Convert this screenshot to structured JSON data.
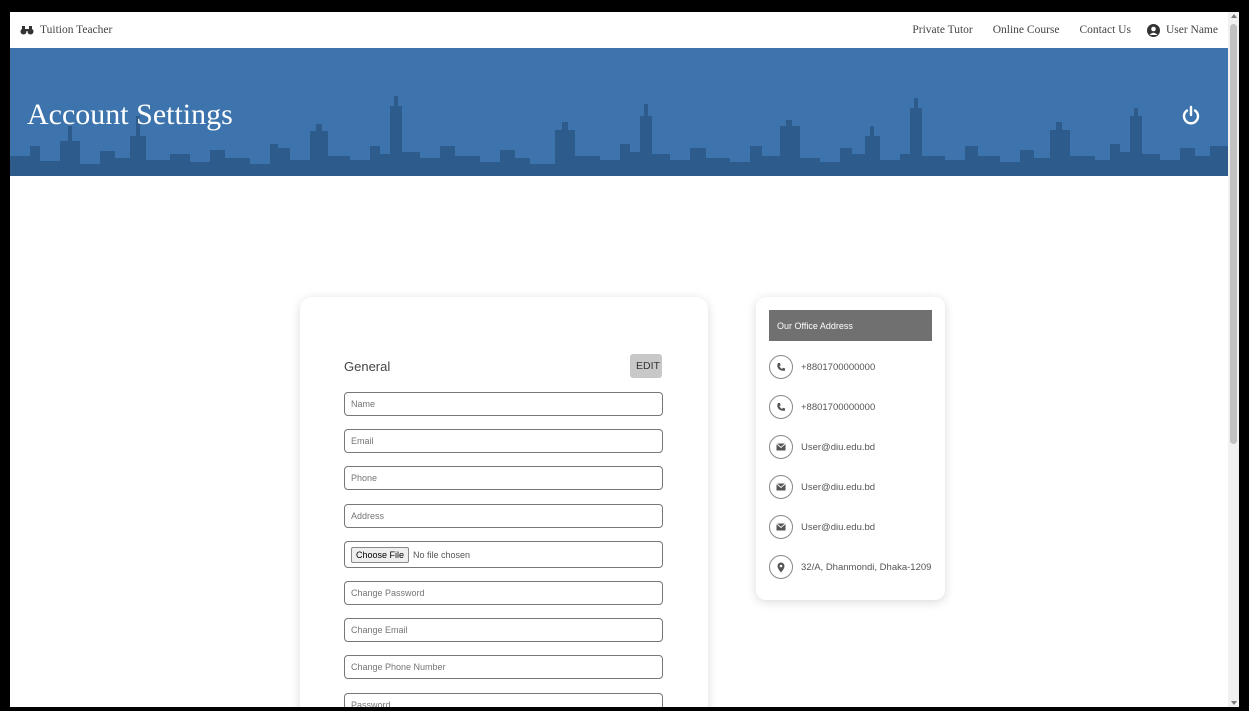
{
  "nav": {
    "brand": "Tuition Teacher",
    "links": [
      "Private Tutor",
      "Online Course",
      "Contact Us"
    ],
    "user": "User Name"
  },
  "banner": {
    "title": "Account Settings"
  },
  "general": {
    "title": "General",
    "edit_label": "EDIT",
    "fields": {
      "name": "Name",
      "email": "Email",
      "phone": "Phone",
      "address": "Address",
      "change_password": "Change Password",
      "change_email": "Change Email",
      "change_phone": "Change Phone Number",
      "password": "Password"
    },
    "file": {
      "button": "Choose File",
      "status": "No file chosen"
    }
  },
  "office": {
    "title": "Our Office Address",
    "phones": [
      "+8801700000000",
      "+8801700000000"
    ],
    "emails": [
      "User@diu.edu.bd",
      "User@diu.edu.bd",
      "User@diu.edu.bd"
    ],
    "address": "32/A, Dhanmondi, Dhaka-1209"
  },
  "colors": {
    "banner": "#3d74ad",
    "office_header": "#707070",
    "edit_button": "#c8c8c8"
  }
}
